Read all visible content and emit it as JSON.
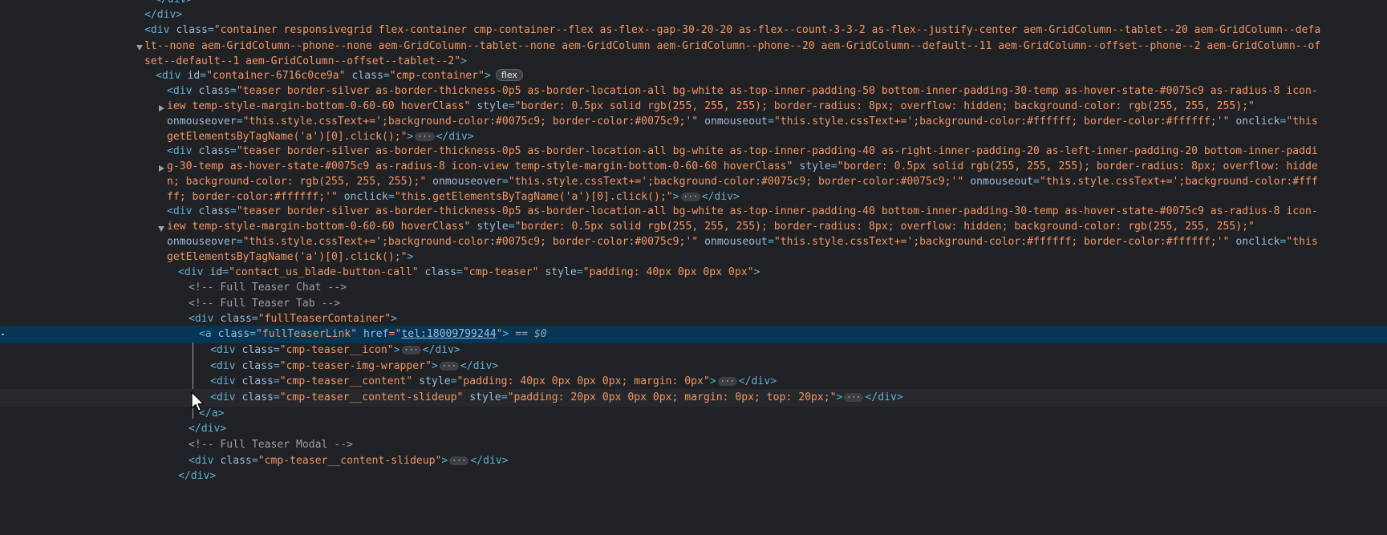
{
  "dom": {
    "row_close_div_top": "</div>",
    "container": {
      "open": "<div",
      "class_attr": "class",
      "class_value_line1": "\"container responsivegrid flex-container cmp-container--flex as-flex--gap-30-20-20 as-flex--count-3-3-2 as-flex--justify-center aem-GridColumn--tablet--20 aem-GridColumn--defa",
      "class_value_line2": "lt--none aem-GridColumn--phone--none aem-GridColumn--tablet--none aem-GridColumn aem-GridColumn--phone--20 aem-GridColumn--default--11 aem-GridColumn--offset--phone--2 aem-GridColumn--of",
      "class_value_line3": "set--default--1 aem-GridColumn--offset--tablet--2\"",
      "close_bracket": ">"
    },
    "cmp_container": {
      "open": "<div",
      "id_attr": "id",
      "id_value": "\"container-6716c0ce9a\"",
      "class_attr": "class",
      "class_value": "\"cmp-container\"",
      "close_bracket": ">",
      "badge": "flex"
    },
    "teaser1": {
      "open": "<div",
      "class_attr": "class",
      "class_value_line1": "\"teaser border-silver as-border-thickness-0p5 as-border-location-all bg-white as-top-inner-padding-50 bottom-inner-padding-30-temp as-hover-state-#0075c9 as-radius-8 icon-",
      "class_value_line2": "iew temp-style-margin-bottom-0-60-60 hoverClass\"",
      "style_attr": "style",
      "style_value": "\"border: 0.5px solid rgb(255, 255, 255); border-radius: 8px; overflow: hidden; background-color: rgb(255, 255, 255);\"",
      "mouseover_attr": "onmouseover",
      "mouseover_value": "\"this.style.cssText+=';background-color:#0075c9; border-color:#0075c9;'\"",
      "mouseout_attr": "onmouseout",
      "mouseout_value": "\"this.style.cssText+=';background-color:#ffffff; border-color:#ffffff;'\"",
      "onclick_attr": "onclick",
      "onclick_value_line1": "\"this",
      "onclick_value_line2": "getElementsByTagName('a')[0].click();\"",
      "close_bracket": ">",
      "ellipsis": "···",
      "close_tag": "</div>"
    },
    "teaser2": {
      "open": "<div",
      "class_attr": "class",
      "class_value_line1": "\"teaser border-silver as-border-thickness-0p5 as-border-location-all bg-white as-top-inner-padding-40 as-right-inner-padding-20 as-left-inner-padding-20 bottom-inner-paddi",
      "class_value_line2": "g-30-temp as-hover-state-#0075c9 as-radius-8 icon-view temp-style-margin-bottom-0-60-60 hoverClass\"",
      "style_attr": "style",
      "style_value_line2": "\"border: 0.5px solid rgb(255, 255, 255); border-radius: 8px; overflow: hidde",
      "style_value_line3": "n; background-color: rgb(255, 255, 255);\"",
      "mouseover_attr": "onmouseover",
      "mouseover_value": "\"this.style.cssText+=';background-color:#0075c9; border-color:#0075c9;'\"",
      "mouseout_attr": "onmouseout",
      "mouseout_value_line3": "\"this.style.cssText+=';background-color:#fff",
      "mouseout_value_line4": "ff; border-color:#ffffff;'\"",
      "onclick_attr": "onclick",
      "onclick_value": "\"this.getElementsByTagName('a')[0].click();\"",
      "close_bracket": ">",
      "ellipsis": "···",
      "close_tag": "</div>"
    },
    "teaser3": {
      "open": "<div",
      "class_attr": "class",
      "class_value_line1": "\"teaser border-silver as-border-thickness-0p5 as-border-location-all bg-white as-top-inner-padding-40 bottom-inner-padding-30-temp as-hover-state-#0075c9 as-radius-8 icon-",
      "class_value_line2": "iew temp-style-margin-bottom-0-60-60 hoverClass\"",
      "style_attr": "style",
      "style_value": "\"border: 0.5px solid rgb(255, 255, 255); border-radius: 8px; overflow: hidden; background-color: rgb(255, 255, 255);\"",
      "mouseover_attr": "onmouseover",
      "mouseover_value": "\"this.style.cssText+=';background-color:#0075c9; border-color:#0075c9;'\"",
      "mouseout_attr": "onmouseout",
      "mouseout_value": "\"this.style.cssText+=';background-color:#ffffff; border-color:#ffffff;'\"",
      "onclick_attr": "onclick",
      "onclick_value_line1": "\"this",
      "onclick_value_line2": "getElementsByTagName('a')[0].click();\"",
      "close_bracket": ">"
    },
    "cmp_teaser": {
      "open": "<div",
      "id_attr": "id",
      "id_value": "\"contact_us_blade-button-call\"",
      "class_attr": "class",
      "class_value": "\"cmp-teaser\"",
      "style_attr": "style",
      "style_value": "\"padding: 40px 0px 0px 0px\"",
      "close_bracket": ">"
    },
    "comment_chat": "<!-- Full Teaser Chat -->",
    "comment_tab": "<!-- Full Teaser Tab -->",
    "full_teaser_container": {
      "open": "<div",
      "class_attr": "class",
      "class_value": "\"fullTeaserContainer\"",
      "close_bracket": ">"
    },
    "full_teaser_link": {
      "open": "<a",
      "class_attr": "class",
      "class_value": "\"fullTeaserLink\"",
      "href_attr": "href",
      "href_eq": "=\"",
      "href_value": "tel:18009799244",
      "href_end": "\"",
      "close_bracket": ">",
      "selected_marker": " == ",
      "dollar": "$0"
    },
    "teaser_icon": {
      "open": "<div",
      "class_attr": "class",
      "class_value": "\"cmp-teaser__icon\"",
      "close_bracket": ">",
      "ellipsis": "···",
      "close_tag": "</div>"
    },
    "teaser_img_wrapper": {
      "open": "<div",
      "class_attr": "class",
      "class_value": "\"cmp-teaser-img-wrapper\"",
      "close_bracket": ">",
      "ellipsis": "···",
      "close_tag": "</div>"
    },
    "teaser_content": {
      "open": "<div",
      "class_attr": "class",
      "class_value": "\"cmp-teaser__content\"",
      "style_attr": "style",
      "style_value": "\"padding: 40px 0px 0px 0px; margin: 0px\"",
      "close_bracket": ">",
      "ellipsis": "···",
      "close_tag": "</div>"
    },
    "teaser_content_slideup": {
      "open": "<div",
      "class_attr": "class",
      "class_value": "\"cmp-teaser__content-slideup\"",
      "style_attr": "style",
      "style_value": "\"padding: 20px 0px 0px 0px; margin: 0px; top: 20px;\"",
      "close_bracket": ">",
      "ellipsis": "···",
      "close_tag": "</div>"
    },
    "close_a": "</a>",
    "close_div_1": "</div>",
    "comment_modal": "<!-- Full Teaser Modal -->",
    "content_slideup_2": {
      "open": "<div",
      "class_attr": "class",
      "class_value": "\"cmp-teaser__content-slideup\"",
      "close_bracket": ">",
      "ellipsis": "···",
      "close_tag": "</div>"
    },
    "close_div_2": "</div>"
  },
  "colors": {
    "background": "#202124",
    "tag": "#5db0d7",
    "attr_name": "#9bbbdc",
    "attr_value": "#f29766",
    "selected_row": "#073655",
    "hover_row": "#26282c"
  }
}
